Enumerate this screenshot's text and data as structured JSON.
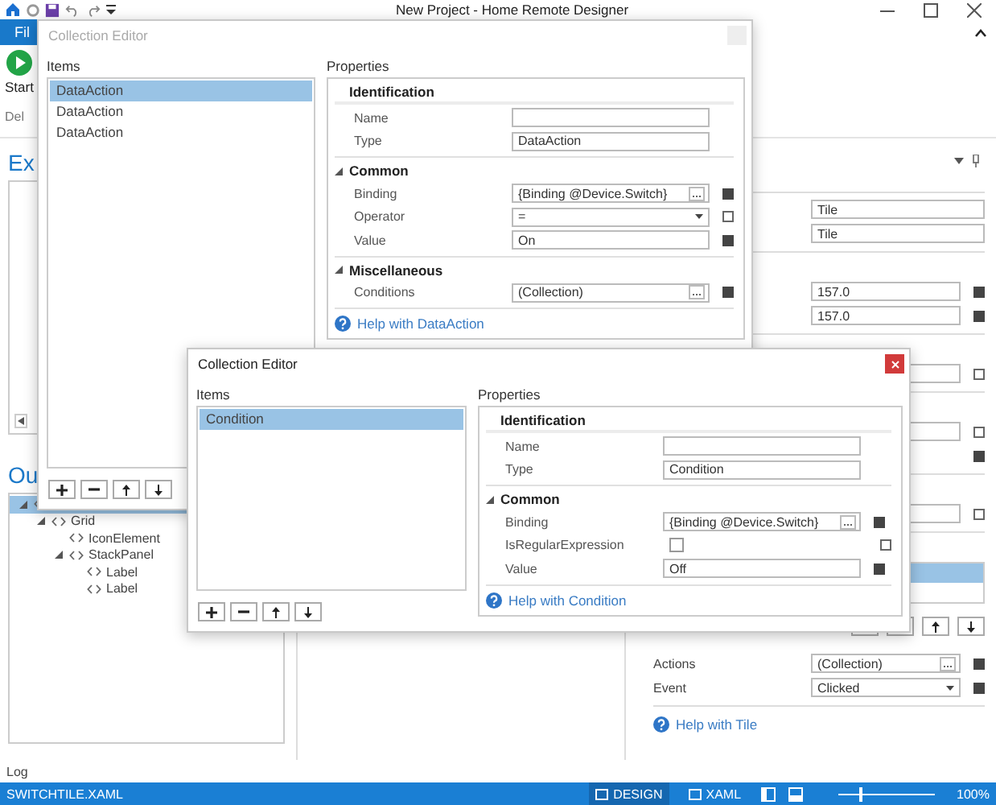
{
  "window": {
    "title": "New Project - Home Remote Designer"
  },
  "ribbon": {
    "tabs": [
      {
        "label": "Fil",
        "selected": true
      }
    ],
    "start": "Start",
    "group_label": "Del"
  },
  "explorer": {
    "heading": "Ex"
  },
  "outline": {
    "heading": "Ou",
    "tree": [
      {
        "selected": true,
        "expanded": true,
        "children": [
          {
            "label": "Grid",
            "expanded": true,
            "selected": false,
            "children": [
              {
                "label": "IconElement",
                "selected": false
              },
              {
                "label": "StackPanel",
                "expanded": true,
                "selected": false,
                "children": [
                  {
                    "label": "Label",
                    "selected": false
                  },
                  {
                    "label": "Label",
                    "selected": false
                  }
                ]
              }
            ]
          }
        ]
      }
    ]
  },
  "properties_panel": {
    "sections": [
      {
        "rows": [
          {
            "kind": "text",
            "value": "Tile"
          },
          {
            "kind": "text",
            "value": "Tile"
          }
        ]
      },
      {
        "rows": [
          {
            "kind": "text",
            "value": "157.0",
            "bound": true
          },
          {
            "kind": "text",
            "value": "157.0",
            "bound": true
          }
        ]
      },
      {
        "rows": [
          {
            "kind": "text",
            "bound": false
          }
        ]
      },
      {
        "rows": [
          {
            "kind": "text",
            "bound": false
          },
          {
            "kind": "marker",
            "bound": true
          }
        ]
      },
      {
        "rows": [
          {
            "kind": "text",
            "bound": false
          }
        ]
      },
      {
        "rows": [
          {
            "kind": "list",
            "items": [
              {
                "selected": true
              }
            ]
          },
          {
            "kind": "button",
            "label": "Actions",
            "value": "(Collection)",
            "bound": true
          },
          {
            "kind": "dropdown",
            "label": "Event",
            "value": "Clicked",
            "bound": true
          }
        ]
      }
    ],
    "help": "Help with Tile"
  },
  "log": "Log",
  "status_bar": {
    "file": "SWITCHTILE.XAML",
    "views": [
      {
        "label": "DESIGN",
        "selected": true
      },
      {
        "label": "XAML",
        "selected": false
      }
    ],
    "zoom": {
      "level": 0.22,
      "reading": "100%"
    }
  },
  "dialogs": [
    {
      "title": "Collection Editor",
      "active": false,
      "items_label": "Items",
      "items": [
        {
          "label": "DataAction",
          "selected": true
        },
        {
          "label": "DataAction",
          "selected": false
        },
        {
          "label": "DataAction",
          "selected": false
        }
      ],
      "properties_label": "Properties",
      "categories": [
        {
          "name": "Identification",
          "rows": [
            {
              "label": "Name",
              "kind": "text"
            },
            {
              "label": "Type",
              "kind": "text",
              "value": "DataAction"
            }
          ]
        },
        {
          "name": "Common",
          "expanded": true,
          "rows": [
            {
              "label": "Binding",
              "kind": "button",
              "value": "{Binding @Device.Switch}",
              "bound": true
            },
            {
              "label": "Operator",
              "kind": "dropdown",
              "value": "=",
              "bound": false
            },
            {
              "label": "Value",
              "kind": "text",
              "value": "On",
              "bound": true
            }
          ]
        },
        {
          "name": "Miscellaneous",
          "expanded": true,
          "rows": [
            {
              "label": "Conditions",
              "kind": "button",
              "value": "(Collection)",
              "bound": true
            }
          ]
        }
      ],
      "help": "Help with DataAction"
    },
    {
      "title": "Collection Editor",
      "active": true,
      "items_label": "Items",
      "items": [
        {
          "label": "Condition",
          "selected": true
        }
      ],
      "properties_label": "Properties",
      "categories": [
        {
          "name": "Identification",
          "rows": [
            {
              "label": "Name",
              "kind": "text"
            },
            {
              "label": "Type",
              "kind": "text",
              "value": "Condition"
            }
          ]
        },
        {
          "name": "Common",
          "expanded": true,
          "rows": [
            {
              "label": "Binding",
              "kind": "button",
              "value": "{Binding @Device.Switch}",
              "bound": true
            },
            {
              "label": "IsRegularExpression",
              "kind": "checkbox",
              "checked": false,
              "bound": false
            },
            {
              "label": "Value",
              "kind": "text",
              "value": "Off",
              "bound": true
            }
          ]
        }
      ],
      "help": "Help with Condition"
    }
  ]
}
